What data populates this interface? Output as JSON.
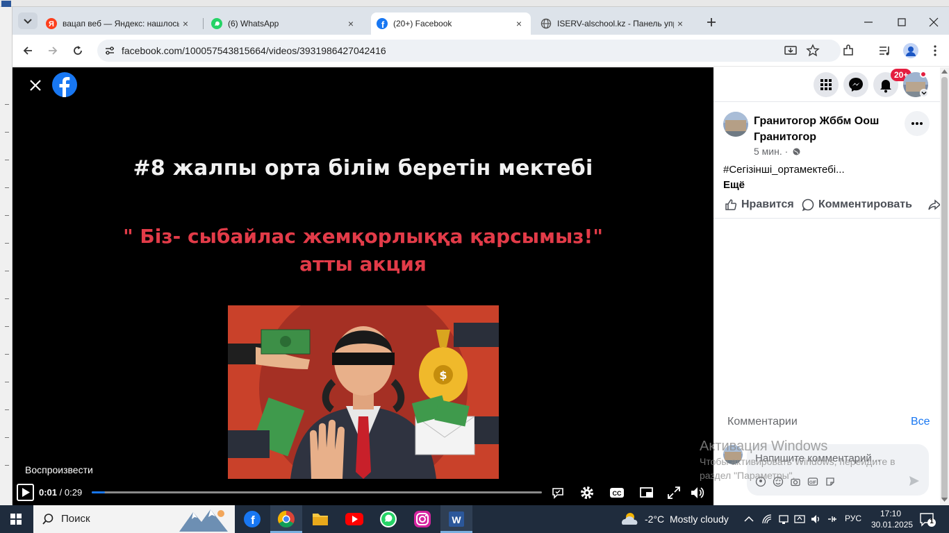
{
  "browser": {
    "tabs": [
      {
        "title": "вацап веб — Яндекс: нашлось",
        "favicon": "yandex-icon",
        "active": false
      },
      {
        "title": "(6) WhatsApp",
        "favicon": "whatsapp-icon",
        "active": false
      },
      {
        "title": "(20+) Facebook",
        "favicon": "facebook-icon",
        "active": true
      },
      {
        "title": "ISERV-alschool.kz - Панель упр",
        "favicon": "globe-icon",
        "active": false
      }
    ],
    "url": "facebook.com/100057543815664/videos/3931986427042416"
  },
  "video": {
    "headline": "#8 жалпы орта білім беретін мектебі",
    "slogan_line1": "\" Біз- сыбайлас жемқорлыққа қарсымыз!\"",
    "slogan_line2": "атты акция",
    "play_label": "Воспроизвести",
    "current_time": "0:01",
    "separator": " / ",
    "duration": "0:29",
    "progress_fraction": 0.03
  },
  "panel": {
    "notification_badge": "20+",
    "post": {
      "author": "Гранитогор Жббм Оош Гранитогор",
      "time": "5 мин. ·",
      "text": "#Сегізінші_ортамектебі...",
      "more": "Ещё"
    },
    "actions": {
      "like": "Нравится",
      "comment": "Комментировать"
    },
    "comments": {
      "title": "Комментарии",
      "all": "Все",
      "placeholder": "Напишите комментарий..."
    },
    "activation": {
      "title": "Активация Windows",
      "line1": "Чтобы активировать Windows, перейдите в",
      "line2": "раздел \"Параметры\"."
    }
  },
  "taskbar": {
    "search": "Поиск",
    "temperature": "-2°C",
    "weather": "Mostly cloudy",
    "language": "РУС",
    "time": "17:10",
    "date": "30.01.2025",
    "notifications": "1"
  },
  "colors": {
    "facebook_blue": "#1877f2",
    "slogan_red": "#e23b48",
    "badge_red": "#e41e3f",
    "taskbar": "#1f2c3d"
  }
}
